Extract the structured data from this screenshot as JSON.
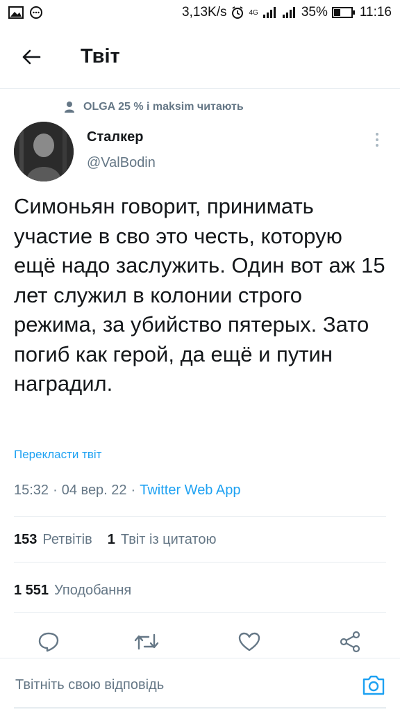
{
  "status_bar": {
    "network_speed": "3,13K/s",
    "network_type": "4G",
    "battery": "35%",
    "time": "11:16"
  },
  "header": {
    "title": "Твіт"
  },
  "social_context": {
    "text": "OLGA 25 % і maksim читають"
  },
  "tweet": {
    "author_name": "Сталкер",
    "author_handle": "@ValBodin",
    "text": "Симоньян говорит, принимать участие в сво это честь, которую ещё надо заслужить. Один вот аж 15 лет служил в колонии строго режима, за убийство пятерых. Зато погиб как герой, да ещё и путин наградил.",
    "translate_label": "Перекласти твіт",
    "time": "15:32",
    "date": "04 вер. 22",
    "source": "Twitter Web App",
    "separator": "·"
  },
  "stats": {
    "retweets_count": "153",
    "retweets_label": "Ретвітів",
    "quotes_count": "1",
    "quotes_label": "Твіт із цитатою",
    "likes_count": "1 551",
    "likes_label": "Уподобання"
  },
  "reply_bar": {
    "placeholder": "Твітніть свою відповідь"
  },
  "colors": {
    "accent": "#1da1f2",
    "secondary_text": "#657786",
    "divider": "#e6ecf0"
  },
  "icons": {
    "back": "arrow-left-icon",
    "reply": "comment-icon",
    "retweet": "retweet-icon",
    "like": "heart-icon",
    "share": "share-icon",
    "camera": "camera-icon",
    "more": "more-vertical-icon"
  }
}
